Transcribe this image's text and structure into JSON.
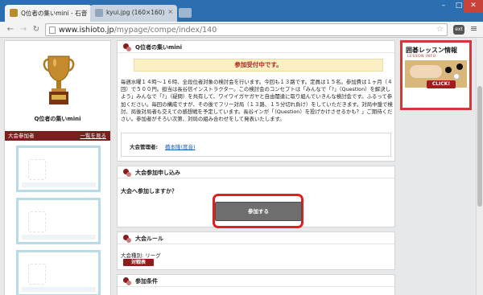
{
  "browser": {
    "tabs": [
      {
        "title": "Q位者の集いmini - 石音",
        "active": true
      },
      {
        "title": "kyui.jpg (160×160)",
        "active": false
      }
    ],
    "url_host": "www.ishioto.jp",
    "url_path": "/mypage/compe/index/140",
    "window_controls": {
      "minimize": "–",
      "maximize": "□",
      "close": "✕"
    },
    "nav": {
      "back": "←",
      "forward": "→",
      "reload": "↻"
    },
    "star": "☆",
    "menu": "≡",
    "extension": "ext"
  },
  "left_column": {
    "event_name": "Q位者の集いmini",
    "participants_header": "大会参加者",
    "participants_link": "一覧を見る",
    "trophy_icon": "trophy-icon",
    "participant_cards": 3
  },
  "main": {
    "section1": {
      "title": "Q位者の集いmini",
      "status": "参加受付中です。",
      "description": "毎週水曜１４時～１６時、全段位者対象の検討会を行います。今回も１３路です。定員は１５名。参加費は１ヶ月（４回）で５００円。担当は長谷信インストラクター。この検討会のコンセプトは「みんなで「?」（Question）を解決しよう」みんなで「?」（疑問）を共有して、ワイワイガヤガヤと自由闊達に取り組んでいきんな検討会です。ふるって参加ください。毎回の構成ですが、その後でフリー対局（１３路、１５分切れ負け）をしていただきます。対局中盤で検討、局後対局者も交えての感想戦を予定しています。長谷インが「（Question）を投げかけさせるかも？」ご期待ください。参加者がそろい次第、対局の組み合わせをして発表いたします。",
      "admin_label": "大会管理者:",
      "admin_name": "橋本隆(度音)"
    },
    "section2": {
      "title": "大会参加申し込み",
      "question": "大会へ参加しますか？",
      "join_button": "参加する"
    },
    "section3": {
      "title": "大会ルール",
      "rule_label": "大会種別: リーグ",
      "match_button": "対戦表"
    },
    "section4": {
      "title": "参加条件"
    }
  },
  "right_column": {
    "banner_title": "囲碁レッスン情報",
    "banner_subtitle": "LESSON INFO",
    "click_label": "CLICK!"
  },
  "colors": {
    "accent": "#8b1b1b",
    "status_text": "#b3261e",
    "highlight": "#e01f1f",
    "link": "#1a5fb4"
  }
}
